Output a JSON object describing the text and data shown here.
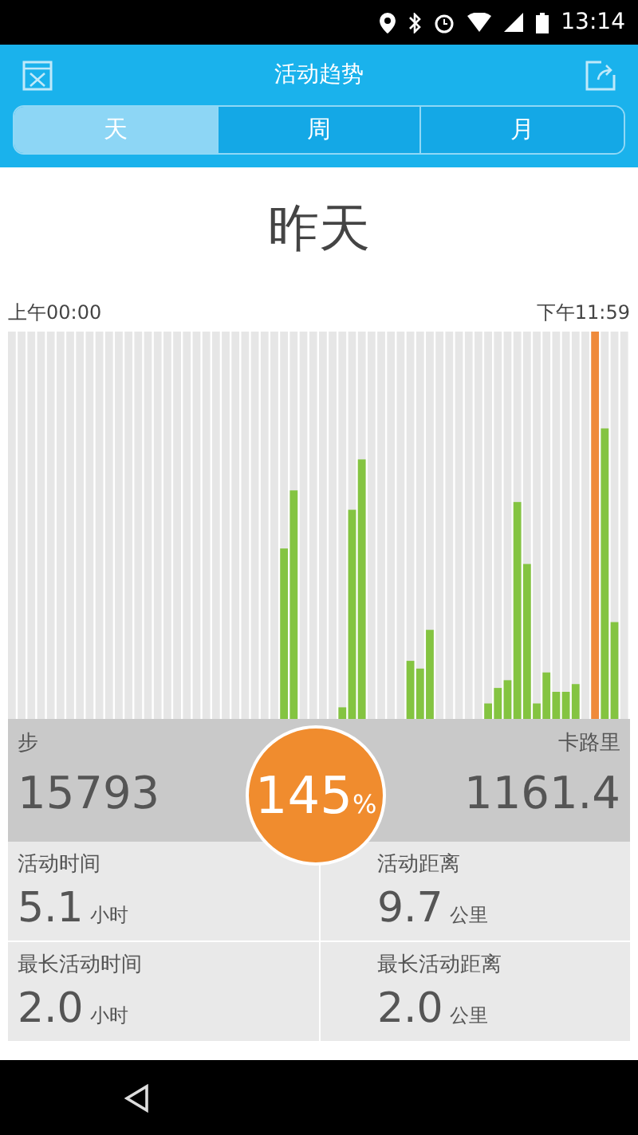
{
  "status_bar": {
    "time": "13:14"
  },
  "header": {
    "title": "活动趋势"
  },
  "tabs": [
    {
      "label": "天",
      "selected": true
    },
    {
      "label": "周",
      "selected": false
    },
    {
      "label": "月",
      "selected": false
    }
  ],
  "day_title": "昨天",
  "chart": {
    "start_label": "上午00:00",
    "end_label": "下午11:59"
  },
  "summary": {
    "steps": {
      "label": "步",
      "value": "15793"
    },
    "calories": {
      "label": "卡路里",
      "value": "1161.4"
    },
    "goal": {
      "value": "145",
      "unit": "%"
    }
  },
  "stats": [
    {
      "label": "活动时间",
      "value": "5.1",
      "unit": "小时"
    },
    {
      "label": "活动距离",
      "value": "9.7",
      "unit": "公里"
    },
    {
      "label": "最长活动时间",
      "value": "2.0",
      "unit": "小时"
    },
    {
      "label": "最长活动距离",
      "value": "2.0",
      "unit": "公里"
    }
  ]
}
